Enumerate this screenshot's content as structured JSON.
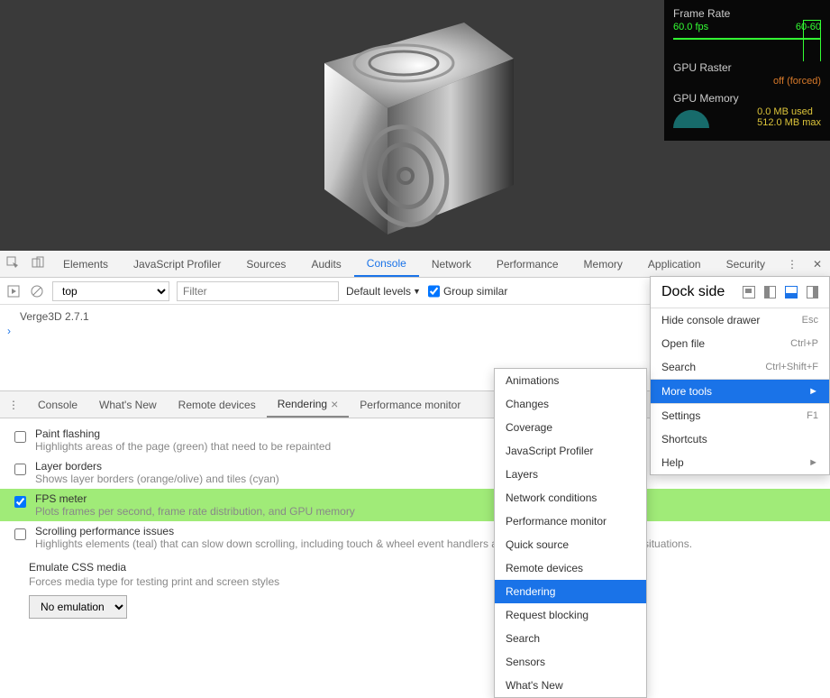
{
  "viewport": {
    "stats": {
      "frame_rate_title": "Frame Rate",
      "fps": "60.0 fps",
      "fps_range": "60-60",
      "gpu_raster_title": "GPU Raster",
      "gpu_raster_status": "off (forced)",
      "gpu_memory_title": "GPU Memory",
      "gpu_mem_used": "0.0 MB used",
      "gpu_mem_max": "512.0 MB max"
    }
  },
  "devtools": {
    "tabs": [
      "Elements",
      "JavaScript Profiler",
      "Sources",
      "Audits",
      "Console",
      "Network",
      "Performance",
      "Memory",
      "Application",
      "Security"
    ],
    "active_tab": "Console",
    "toolbar": {
      "context": "top",
      "filter_placeholder": "Filter",
      "levels": "Default levels",
      "group_similar": "Group similar"
    },
    "console_output": "Verge3D 2.7.1",
    "drawer": {
      "tabs": [
        "Console",
        "What's New",
        "Remote devices",
        "Rendering",
        "Performance monitor"
      ],
      "active_tab": "Rendering",
      "options": [
        {
          "title": "Paint flashing",
          "sub": "Highlights areas of the page (green) that need to be repainted",
          "checked": false
        },
        {
          "title": "Layer borders",
          "sub": "Shows layer borders (orange/olive) and tiles (cyan)",
          "checked": false
        },
        {
          "title": "FPS meter",
          "sub": "Plots frames per second, frame rate distribution, and GPU memory",
          "checked": true,
          "hl": true
        },
        {
          "title": "Scrolling performance issues",
          "sub": "Highlights elements (teal) that can slow down scrolling, including touch & wheel event handlers and other main-thread scrolling situations.",
          "checked": false
        }
      ],
      "emulate": {
        "title": "Emulate CSS media",
        "sub": "Forces media type for testing print and screen styles",
        "value": "No emulation"
      }
    }
  },
  "dock_menu": {
    "dock_side": "Dock side",
    "items": [
      {
        "label": "Hide console drawer",
        "kbd": "Esc"
      },
      {
        "label": "Open file",
        "kbd": "Ctrl+P"
      },
      {
        "label": "Search",
        "kbd": "Ctrl+Shift+F"
      },
      {
        "label": "More tools",
        "kbd": "►",
        "sel": true
      },
      {
        "label": "Settings",
        "kbd": "F1"
      },
      {
        "label": "Shortcuts",
        "kbd": ""
      },
      {
        "label": "Help",
        "kbd": "►"
      }
    ]
  },
  "more_tools": [
    "Animations",
    "Changes",
    "Coverage",
    "JavaScript Profiler",
    "Layers",
    "Network conditions",
    "Performance monitor",
    "Quick source",
    "Remote devices",
    "Rendering",
    "Request blocking",
    "Search",
    "Sensors",
    "What's New"
  ],
  "more_tools_sel": "Rendering"
}
